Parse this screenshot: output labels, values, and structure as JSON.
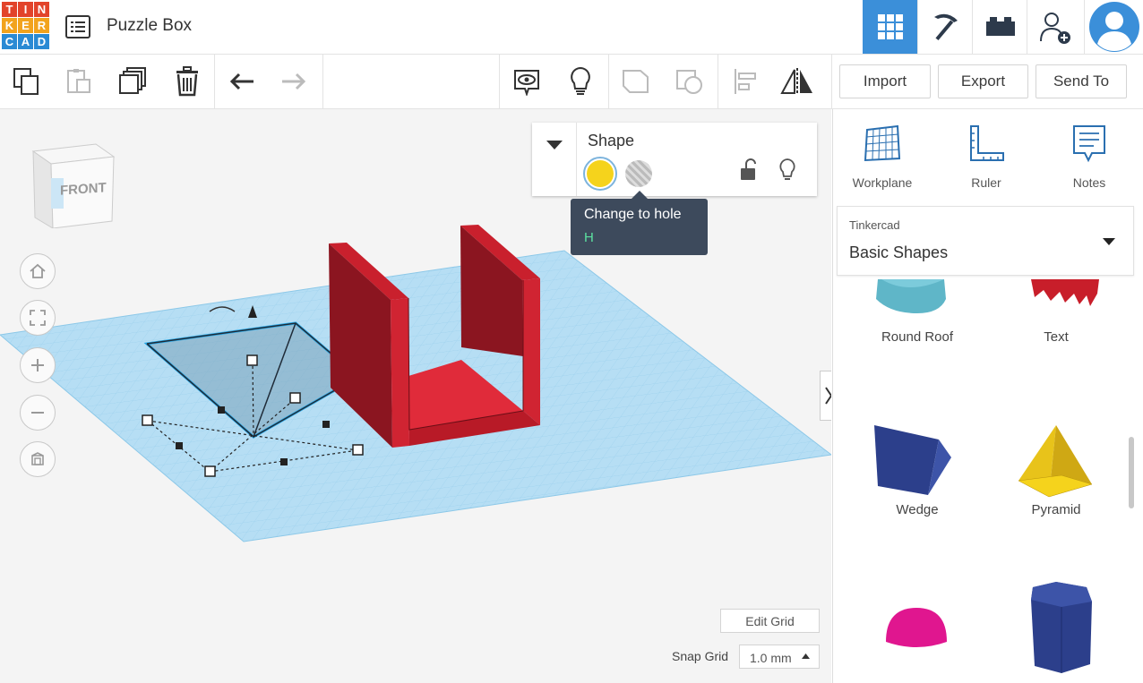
{
  "app": {
    "logo_letters": [
      "T",
      "I",
      "N",
      "K",
      "E",
      "R",
      "C",
      "A",
      "D"
    ],
    "logo_colors": [
      "#e2432a",
      "#e2432a",
      "#e2432a",
      "#f2a31d",
      "#f2a31d",
      "#f2a31d",
      "#2a8ad4",
      "#2a8ad4",
      "#2a8ad4"
    ],
    "title": "Puzzle Box"
  },
  "topnav": {
    "items": [
      "grid-view-icon",
      "pickaxe-icon",
      "brick-icon",
      "add-user-icon",
      "avatar"
    ],
    "active_color": "#3b8fd9"
  },
  "toolbar": {
    "import_label": "Import",
    "export_label": "Export",
    "send_to_label": "Send To"
  },
  "inspector": {
    "title": "Shape",
    "solid_color": "#f5d31c",
    "tooltip_text": "Change to hole",
    "tooltip_shortcut": "H"
  },
  "viewcube": {
    "face_label": "FRONT"
  },
  "workplane": {
    "label": "Workplane",
    "edit_grid_label": "Edit Grid",
    "snap_grid_label": "Snap Grid",
    "snap_grid_value": "1.0 mm"
  },
  "right_panel": {
    "tools": [
      {
        "label": "Workplane"
      },
      {
        "label": "Ruler"
      },
      {
        "label": "Notes"
      }
    ],
    "library_source": "Tinkercad",
    "library_name": "Basic Shapes",
    "shapes": [
      {
        "label": "Round Roof"
      },
      {
        "label": "Text"
      },
      {
        "label": "Wedge"
      },
      {
        "label": "Pyramid"
      }
    ]
  }
}
